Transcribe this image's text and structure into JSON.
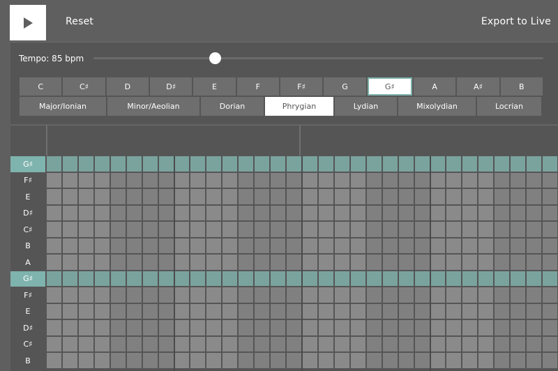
{
  "toolbar": {
    "play_icon": "play-icon",
    "reset_label": "Reset",
    "export_label": "Export to Live"
  },
  "tempo": {
    "label": "Tempo: 85 bpm",
    "value_fraction": 0.27
  },
  "keys": {
    "items": [
      "C",
      "C♯",
      "D",
      "D♯",
      "E",
      "F",
      "F♯",
      "G",
      "G♯",
      "A",
      "A♯",
      "B"
    ],
    "selected": "G♯"
  },
  "modes": {
    "items": [
      "Major/Ionian",
      "Minor/Aeolian",
      "Dorian",
      "Phrygian",
      "Lydian",
      "Mixolydian",
      "Locrian"
    ],
    "selected": "Phrygian"
  },
  "grid": {
    "rows": [
      "G♯",
      "F♯",
      "E",
      "D♯",
      "C♯",
      "B",
      "A",
      "G♯",
      "F♯",
      "E",
      "D♯",
      "C♯",
      "B"
    ],
    "root_note": "G♯",
    "columns": 32,
    "colors": {
      "cell": "#8a8a8a",
      "cell_alt": "#808080",
      "root_cell": "#7aa39e",
      "root_label_bg": "#7fb3ad",
      "grid_line": "#5a5a5a"
    }
  }
}
